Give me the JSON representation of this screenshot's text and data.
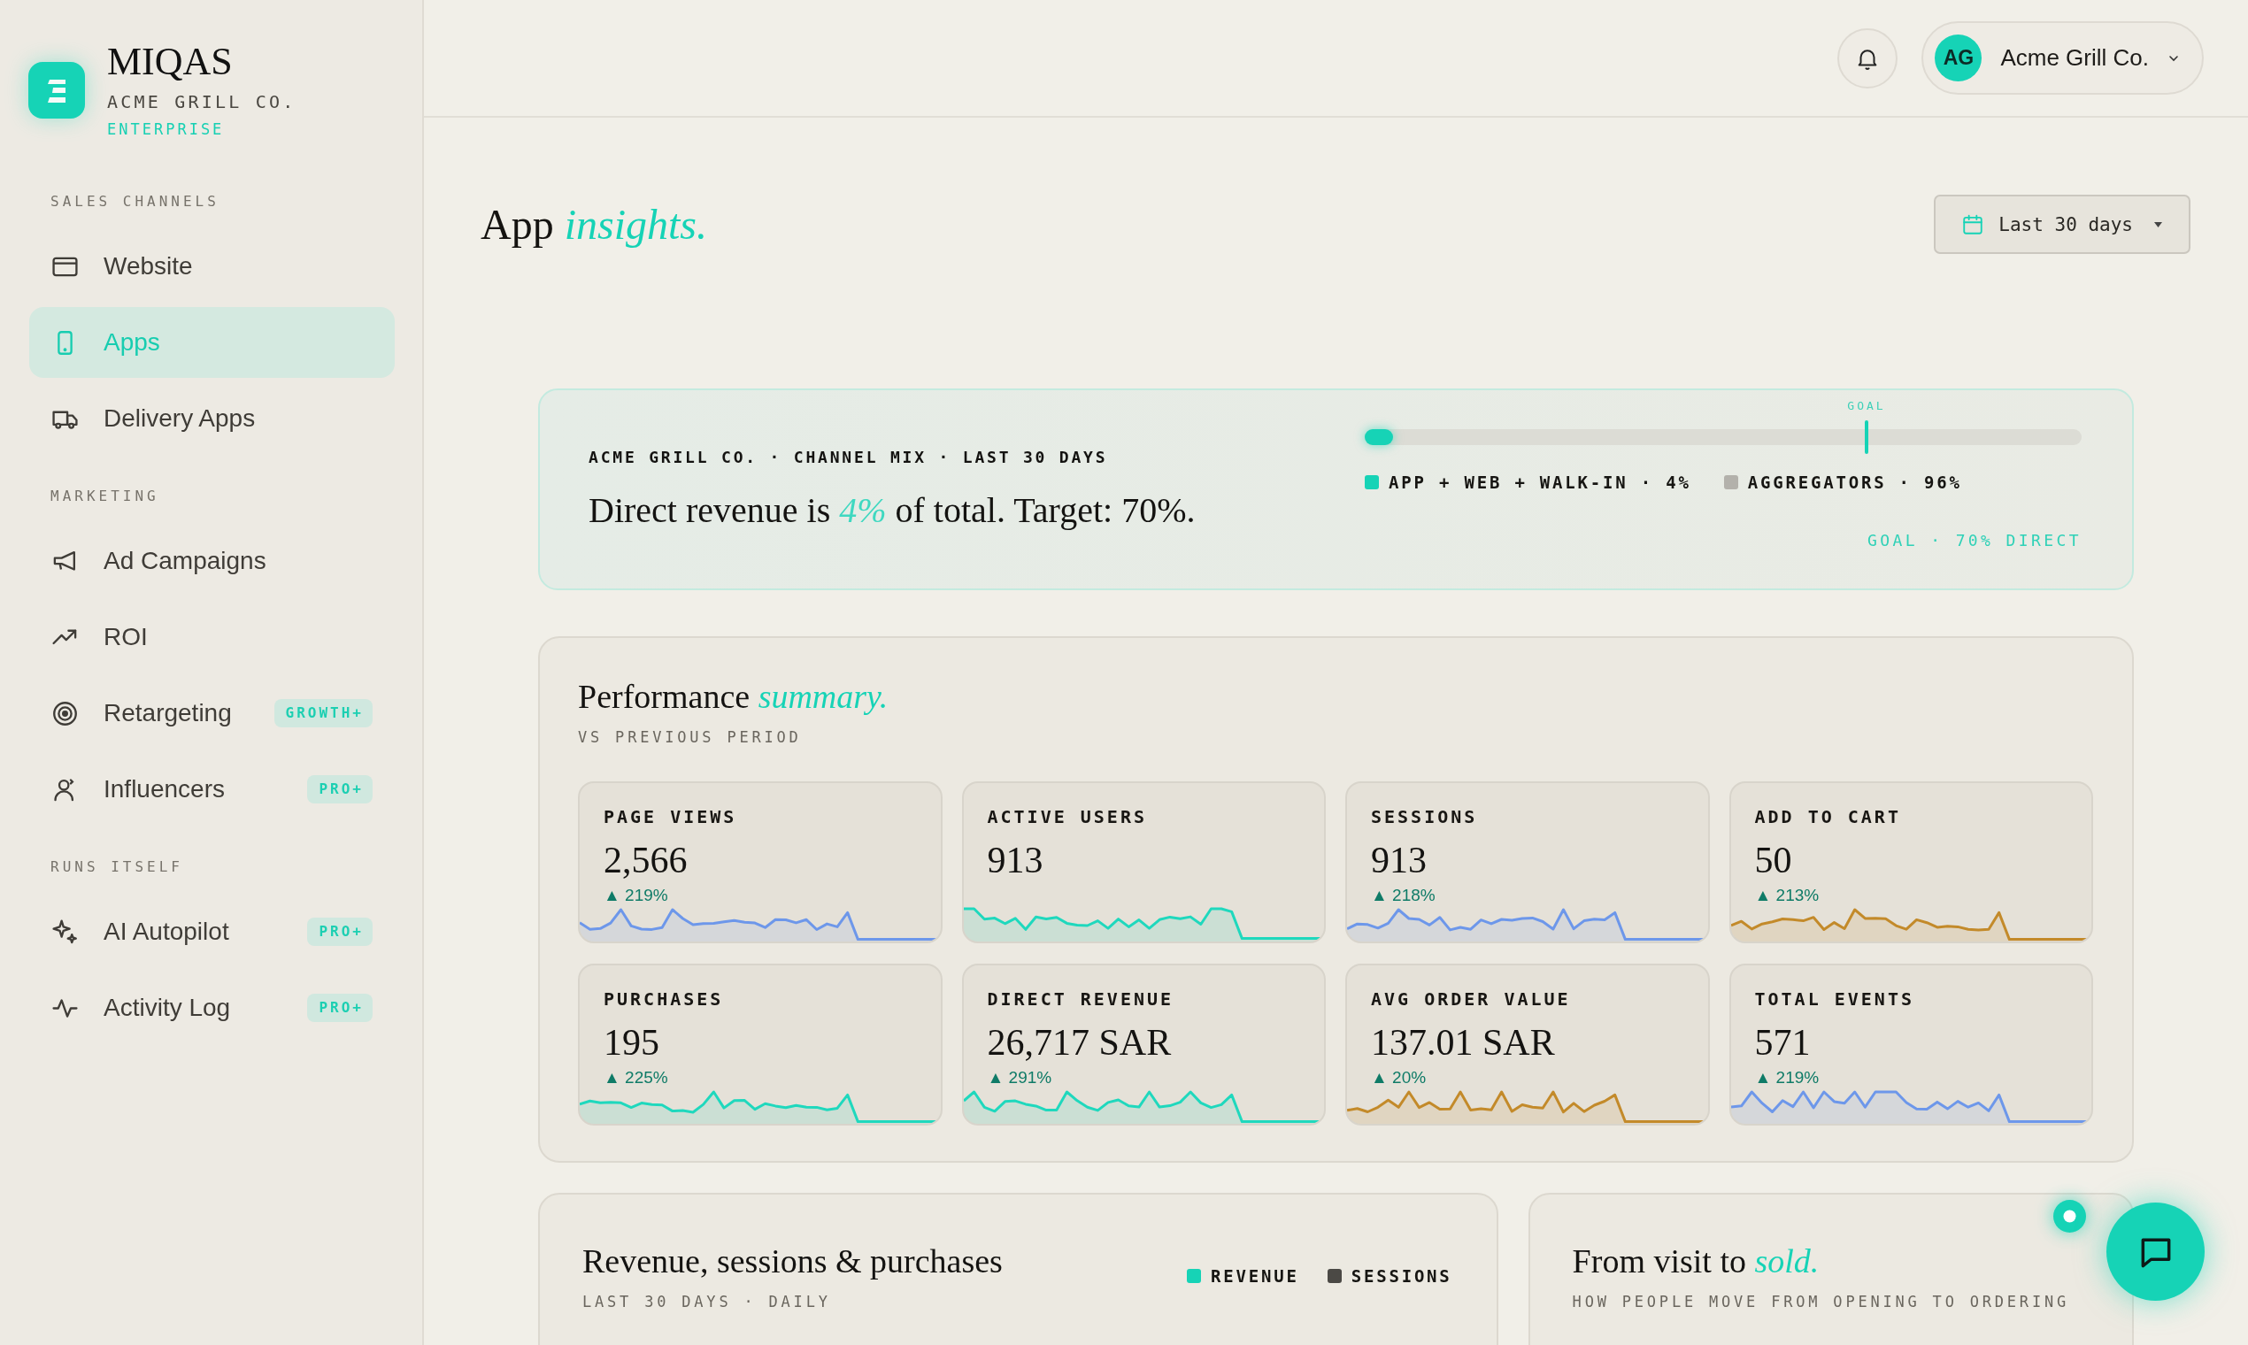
{
  "sidebar": {
    "brand": {
      "name": "MIQAS",
      "company": "ACME GRILL CO.",
      "plan": "ENTERPRISE"
    },
    "sections": [
      {
        "title": "SALES CHANNELS",
        "items": [
          {
            "label": "Website",
            "selected": false
          },
          {
            "label": "Apps",
            "selected": true
          },
          {
            "label": "Delivery Apps",
            "selected": false
          }
        ]
      },
      {
        "title": "MARKETING",
        "items": [
          {
            "label": "Ad Campaigns",
            "selected": false
          },
          {
            "label": "ROI",
            "selected": false
          },
          {
            "label": "Retargeting",
            "selected": false,
            "badge": "GROWTH+"
          },
          {
            "label": "Influencers",
            "selected": false,
            "badge": "PRO+"
          }
        ]
      },
      {
        "title": "RUNS ITSELF",
        "items": [
          {
            "label": "AI Autopilot",
            "selected": false,
            "badge": "PRO+"
          },
          {
            "label": "Activity Log",
            "selected": false,
            "badge": "PRO+"
          }
        ]
      }
    ]
  },
  "header": {
    "account": {
      "initials": "AG",
      "name": "Acme Grill Co."
    }
  },
  "page": {
    "title": "App *insights.*",
    "date_range": "Last 30 days"
  },
  "banner": {
    "eyebrow": "ACME GRILL CO. · CHANNEL MIX · LAST 30 DAYS",
    "headline": "Direct revenue is *4%* of total. Target: 70%.",
    "bar": {
      "level": 0.04
    },
    "goal_marker": {
      "label": "GOAL",
      "level": 0.7
    },
    "legend": [
      {
        "label": "APP + WEB + WALK-IN · 4%",
        "color": "#16d3b6"
      },
      {
        "label": "AGGREGATORS · 96%",
        "color": "#b3b1ab"
      }
    ],
    "goal_note": "GOAL · 70% DIRECT"
  },
  "performance": {
    "title": "Performance *summary.*",
    "subtitle": "VS PREVIOUS PERIOD",
    "metrics": [
      {
        "label": "PAGE VIEWS",
        "value": "2,566",
        "delta": "▲ 219%",
        "color": "#6d97ea"
      },
      {
        "label": "ACTIVE USERS",
        "value": "913",
        "color": "#1fd8bd"
      },
      {
        "label": "SESSIONS",
        "value": "913",
        "delta": "▲ 218%",
        "color": "#6d97ea"
      },
      {
        "label": "ADD TO CART",
        "value": "50",
        "delta": "▲ 213%",
        "color": "#c38a2a"
      },
      {
        "label": "PURCHASES",
        "value": "195",
        "delta": "▲ 225%",
        "color": "#1fd8bd"
      },
      {
        "label": "DIRECT REVENUE",
        "value": "26,717 SAR",
        "delta": "▲ 291%",
        "color": "#1fd8bd"
      },
      {
        "label": "AVG ORDER VALUE",
        "value": "137.01 SAR",
        "delta": "▲ 20%",
        "color": "#c38a2a"
      },
      {
        "label": "TOTAL EVENTS",
        "value": "571",
        "delta": "▲ 219%",
        "color": "#6d97ea"
      }
    ]
  },
  "panels": [
    {
      "title": "Revenue, sessions & purchases",
      "subtitle": "LAST 30 DAYS · DAILY",
      "legend": [
        {
          "label": "REVENUE",
          "color": "#16d3b6"
        },
        {
          "label": "SESSIONS",
          "color": "#4b4945"
        }
      ]
    },
    {
      "title": "From visit to *sold.*",
      "subtitle": "HOW PEOPLE MOVE FROM OPENING TO ORDERING"
    }
  ]
}
